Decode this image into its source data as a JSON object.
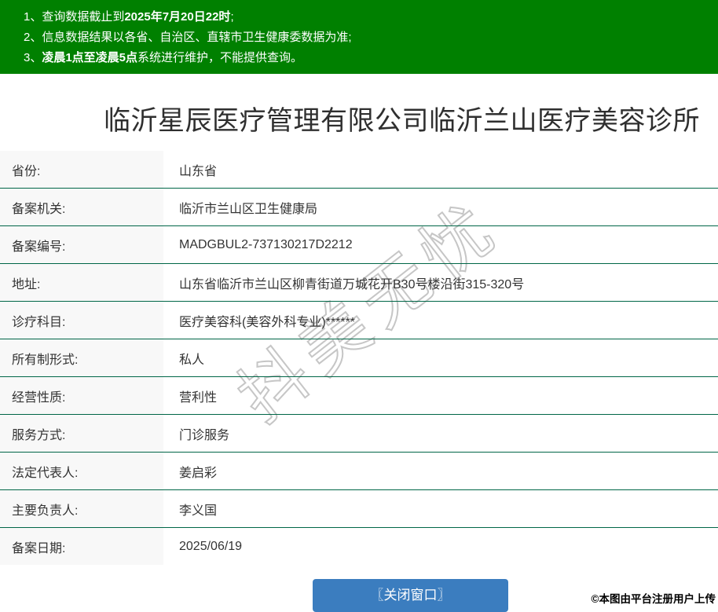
{
  "notices": {
    "items": [
      {
        "pre": "1、查询数据截止到",
        "strong": "2025年7月20日22时",
        "post": ";"
      },
      {
        "pre": "2、信息数据结果以各省、自治区、直辖市卫生健康委数据为准;",
        "strong": "",
        "post": ""
      },
      {
        "pre": "3、",
        "strong": "凌晨1点至凌晨5点",
        "post": "系统进行维护，不能提供查询。"
      }
    ]
  },
  "page": {
    "title": "临沂星辰医疗管理有限公司临沂兰山医疗美容诊所"
  },
  "record": {
    "rows": [
      {
        "label": "省份:",
        "value": "山东省"
      },
      {
        "label": "备案机关:",
        "value": "临沂市兰山区卫生健康局"
      },
      {
        "label": "备案编号:",
        "value": "MADGBUL2-737130217D2212"
      },
      {
        "label": "地址:",
        "value": "山东省临沂市兰山区柳青街道万城花开B30号楼沿街315-320号"
      },
      {
        "label": "诊疗科目:",
        "value": "医疗美容科(美容外科专业)******"
      },
      {
        "label": "所有制形式:",
        "value": "私人"
      },
      {
        "label": "经营性质:",
        "value": "营利性"
      },
      {
        "label": "服务方式:",
        "value": "门诊服务"
      },
      {
        "label": "法定代表人:",
        "value": "姜启彩"
      },
      {
        "label": "主要负责人:",
        "value": "李义国"
      },
      {
        "label": "备案日期:",
        "value": "2025/06/19"
      }
    ]
  },
  "watermark": {
    "text": "抖美无忧"
  },
  "button": {
    "close_label": "〖关闭窗口〗"
  },
  "footer": {
    "copyright": "©本图由平台注册用户上传"
  },
  "colors": {
    "header_green": "#008000",
    "divider_green": "#006647",
    "button_blue": "#3b7dbf",
    "label_bg": "#f8f8f8",
    "text": "#333333"
  }
}
